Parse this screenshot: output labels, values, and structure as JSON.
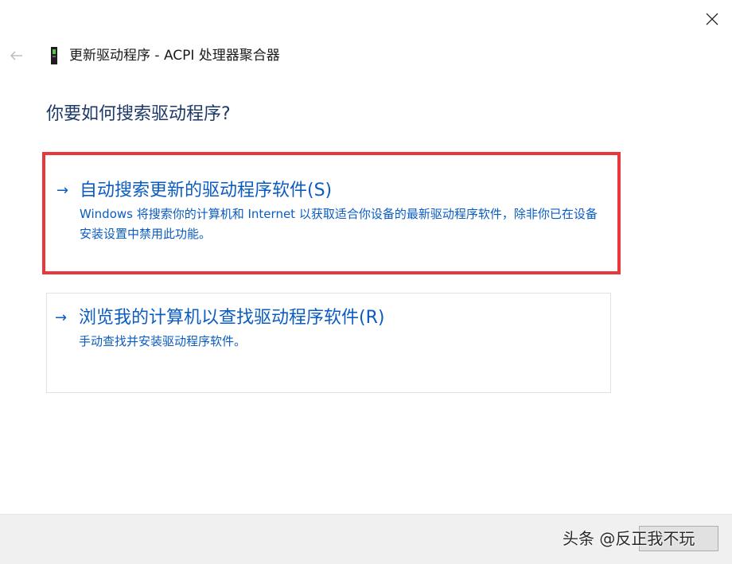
{
  "window": {
    "title": "更新驱动程序 - ACPI 处理器聚合器",
    "icons": {
      "close": "close-icon",
      "back": "back-arrow-icon",
      "device": "device-icon"
    }
  },
  "page": {
    "heading": "你要如何搜索驱动程序?"
  },
  "options": [
    {
      "arrow": "→",
      "title": "自动搜索更新的驱动程序软件(S)",
      "description": "Windows 将搜索你的计算机和 Internet 以获取适合你设备的最新驱动程序软件，除非你已在设备安装设置中禁用此功能。",
      "highlighted": true
    },
    {
      "arrow": "→",
      "title": "浏览我的计算机以查找驱动程序软件(R)",
      "description": "手动查找并安装驱动程序软件。",
      "highlighted": false
    }
  ],
  "footer": {
    "button_label": ""
  },
  "watermark": {
    "text": "头条 @反正我不玩"
  },
  "colors": {
    "link_blue": "#0b5cc0",
    "heading_blue": "#1d3a66",
    "highlight_red": "#e8383c",
    "footer_gray": "#f0f0f0"
  }
}
